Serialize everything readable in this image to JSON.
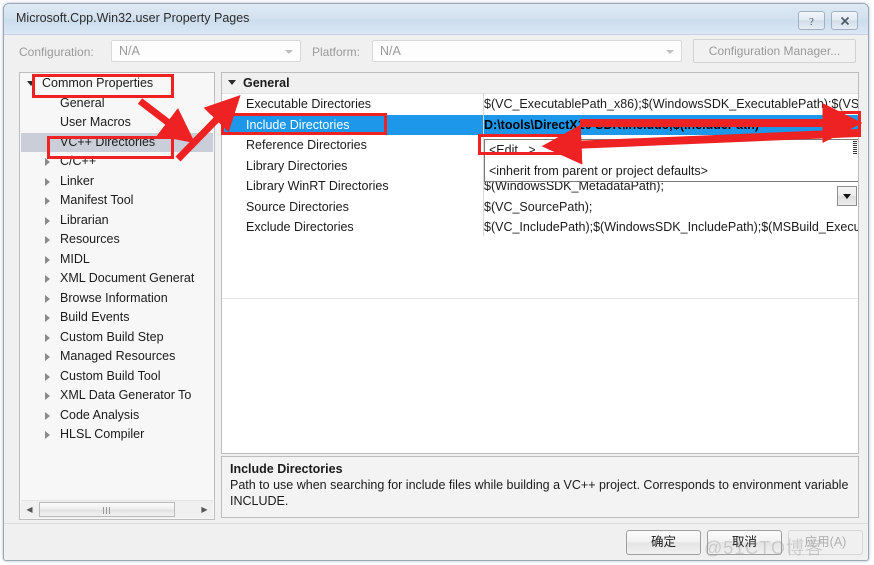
{
  "window": {
    "title": "Microsoft.Cpp.Win32.user Property Pages",
    "help_button": "?",
    "close_button": "x"
  },
  "config_bar": {
    "configuration_label": "Configuration:",
    "configuration_value": "N/A",
    "platform_label": "Platform:",
    "platform_value": "N/A",
    "config_manager_button": "Configuration Manager..."
  },
  "tree": {
    "nodes": [
      {
        "label": "Common Properties",
        "indent": 0,
        "twisty": "expanded",
        "selected": false
      },
      {
        "label": "General",
        "indent": 1,
        "twisty": "none",
        "selected": false
      },
      {
        "label": "User Macros",
        "indent": 1,
        "twisty": "none",
        "selected": false
      },
      {
        "label": "VC++ Directories",
        "indent": 1,
        "twisty": "none",
        "selected": true
      },
      {
        "label": "C/C++",
        "indent": 1,
        "twisty": "collapsed",
        "selected": false
      },
      {
        "label": "Linker",
        "indent": 1,
        "twisty": "collapsed",
        "selected": false
      },
      {
        "label": "Manifest Tool",
        "indent": 1,
        "twisty": "collapsed",
        "selected": false
      },
      {
        "label": "Librarian",
        "indent": 1,
        "twisty": "collapsed",
        "selected": false
      },
      {
        "label": "Resources",
        "indent": 1,
        "twisty": "collapsed",
        "selected": false
      },
      {
        "label": "MIDL",
        "indent": 1,
        "twisty": "collapsed",
        "selected": false
      },
      {
        "label": "XML Document Generat",
        "indent": 1,
        "twisty": "collapsed",
        "selected": false
      },
      {
        "label": "Browse Information",
        "indent": 1,
        "twisty": "collapsed",
        "selected": false
      },
      {
        "label": "Build Events",
        "indent": 1,
        "twisty": "collapsed",
        "selected": false
      },
      {
        "label": "Custom Build Step",
        "indent": 1,
        "twisty": "collapsed",
        "selected": false
      },
      {
        "label": "Managed Resources",
        "indent": 1,
        "twisty": "collapsed",
        "selected": false
      },
      {
        "label": "Custom Build Tool",
        "indent": 1,
        "twisty": "collapsed",
        "selected": false
      },
      {
        "label": "XML Data Generator To",
        "indent": 1,
        "twisty": "collapsed",
        "selected": false
      },
      {
        "label": "Code Analysis",
        "indent": 1,
        "twisty": "collapsed",
        "selected": false
      },
      {
        "label": "HLSL Compiler",
        "indent": 1,
        "twisty": "collapsed",
        "selected": false
      }
    ],
    "scroll_left_arrow": "◀",
    "scroll_right_arrow": "▶"
  },
  "grid": {
    "category": "General",
    "rows": [
      {
        "name": "Executable Directories",
        "value": "$(VC_ExecutablePath_x86);$(WindowsSDK_ExecutablePath);$(VS",
        "selected": false
      },
      {
        "name": "Include Directories",
        "value": "D:\\tools\\DirectX10 SDK\\Include;$(IncludePath)",
        "selected": true
      },
      {
        "name": "Reference Directories",
        "value": "",
        "selected": false
      },
      {
        "name": "Library Directories",
        "value": "",
        "selected": false
      },
      {
        "name": "Library WinRT Directories",
        "value": "$(WindowsSDK_MetadataPath);",
        "selected": false
      },
      {
        "name": "Source Directories",
        "value": "$(VC_SourcePath);",
        "selected": false
      },
      {
        "name": "Exclude Directories",
        "value": "$(VC_IncludePath);$(WindowsSDK_IncludePath);$(MSBuild_Execu",
        "selected": false
      }
    ]
  },
  "dropdown": {
    "items": [
      "<Edit...>",
      "<inherit from parent or project defaults>"
    ]
  },
  "description": {
    "title": "Include Directories",
    "text": "Path to use when searching for include files while building a VC++ project.  Corresponds to environment variable INCLUDE."
  },
  "buttons": {
    "ok": "确定",
    "cancel": "取消",
    "apply": "应用(A)"
  },
  "watermark": "@51CTO博客",
  "colors": {
    "selection_blue": "#1c97ea",
    "tree_selection": "#c9ced9",
    "annotation_red": "#ee2222",
    "titlebar": "#d3e1ef"
  }
}
